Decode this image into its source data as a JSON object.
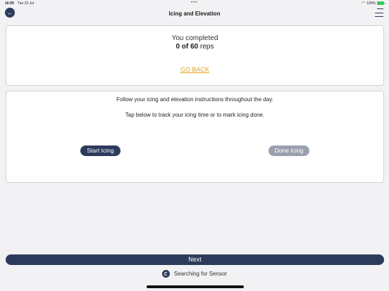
{
  "status_bar": {
    "time": "16:59",
    "date": "Tue 23 Jul",
    "center_dots": "•••",
    "battery": "100%"
  },
  "nav": {
    "title": "Icing and Elevation",
    "back_icon": "arrow-left-icon",
    "menu_icon": "menu-icon"
  },
  "progress_card": {
    "completed_label": "You completed",
    "reps_count": "0 of 60",
    "reps_unit": "reps",
    "go_back_label": "GO BACK"
  },
  "icing_card": {
    "instruction_1": "Follow your icing and elevation instructions throughout the day.",
    "instruction_2": "Tap below to track your icing time or to mark icing done.",
    "start_label": "Start Icing",
    "done_label": "Done Icing"
  },
  "footer": {
    "next_label": "Next",
    "sensor_status": "Searching for Sensor",
    "sensor_icon": "sensor-search-icon"
  },
  "colors": {
    "primary": "#2c3a5c",
    "disabled": "#9aa0ad",
    "link": "#e6a21a",
    "background": "#f2f2f4"
  }
}
